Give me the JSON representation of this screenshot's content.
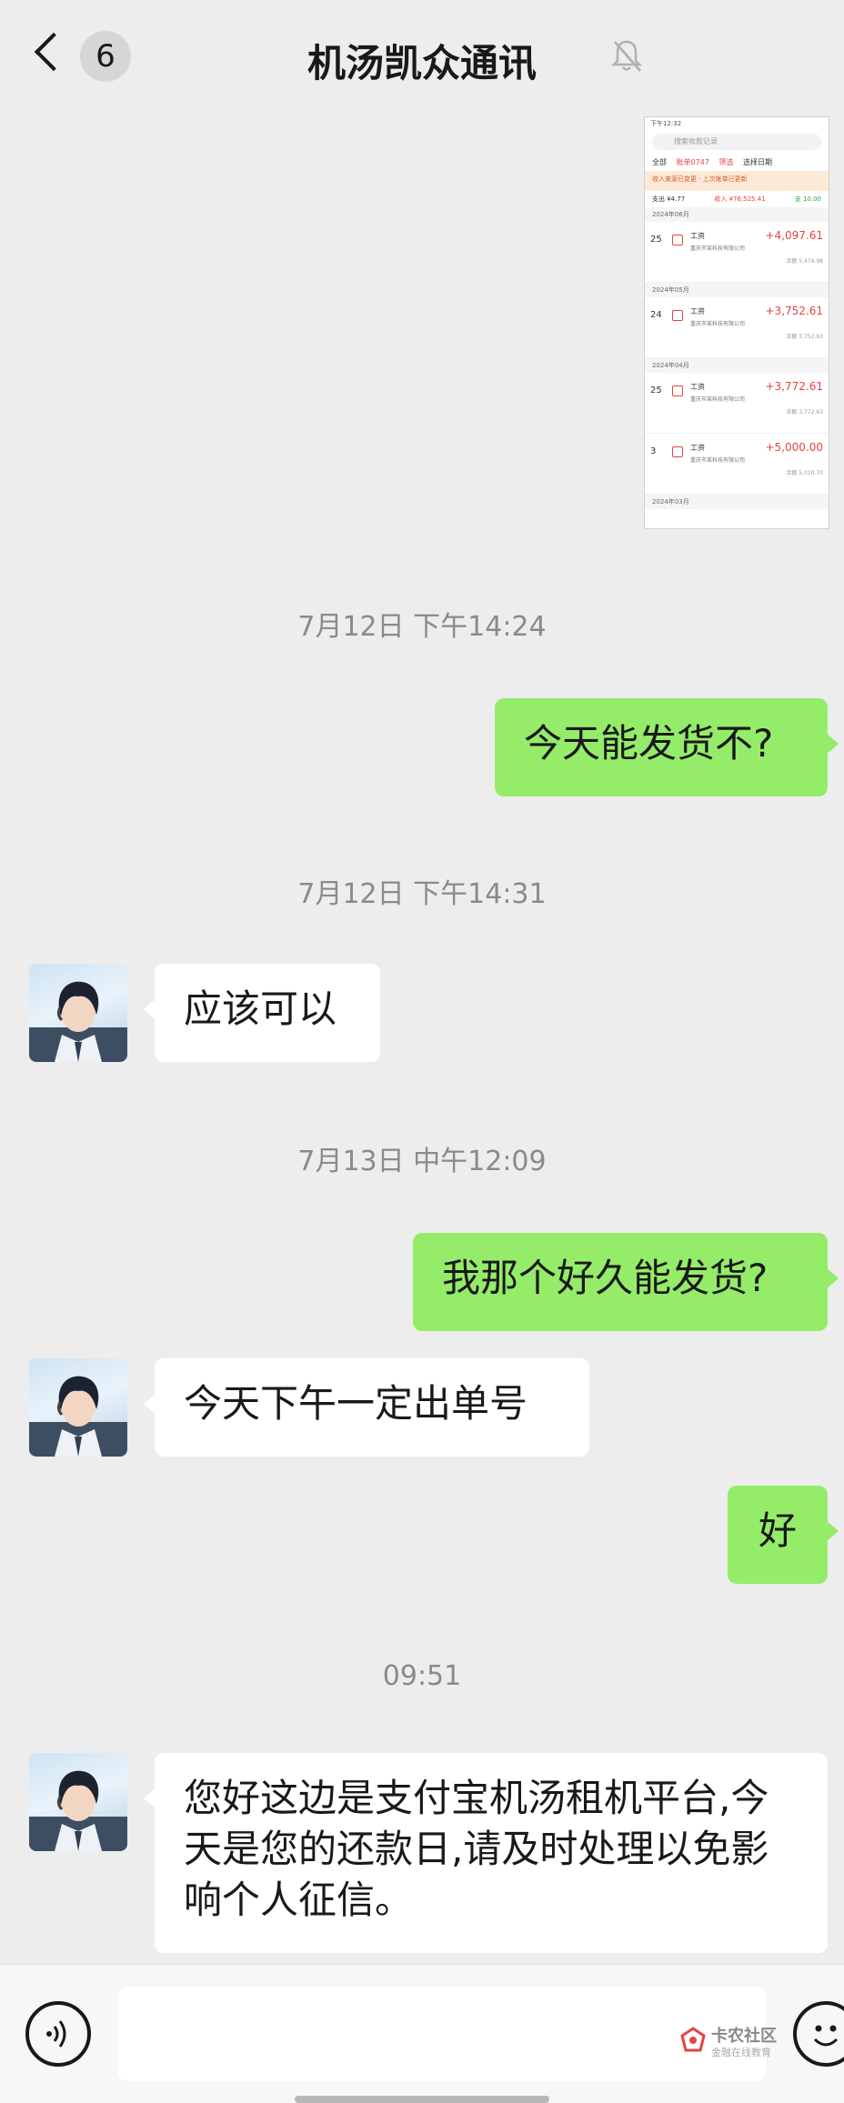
{
  "header": {
    "back_badge": "6",
    "title": "机汤凯众通讯"
  },
  "thumbnail": {
    "status": "下午12:32",
    "search_placeholder": "搜索收款记录",
    "filters": [
      "全部",
      "账单0747",
      "筛选",
      "选择日期"
    ],
    "notice": "收入来源已变更 · 上次账单已更新",
    "summary": {
      "expense": "支出 ¥4.77",
      "income": "收入 ¥76,525.41",
      "other": "支 10.00"
    },
    "records": [
      {
        "month": "2024年06月",
        "day": "25",
        "name": "工资",
        "company": "重庆市某科技有限公司",
        "amount": "+4,097.61",
        "balance": "余额 5,474.98"
      },
      {
        "month": "2024年05月",
        "day": "24",
        "name": "工资",
        "company": "重庆市某科技有限公司",
        "amount": "+3,752.61",
        "balance": "余额 3,752.63"
      },
      {
        "month": "2024年04月",
        "day": "25",
        "name": "工资",
        "company": "重庆市某科技有限公司",
        "amount": "+3,772.61",
        "balance": "余额 3,772.63"
      },
      {
        "month": "",
        "day": "3",
        "name": "工资",
        "company": "重庆市某科技有限公司",
        "amount": "+5,000.00",
        "balance": "余额 5,010.70"
      }
    ],
    "footer_month": "2024年03月"
  },
  "timestamps": [
    "7月12日 下午14:24",
    "7月12日 下午14:31",
    "7月13日 中午12:09",
    "09:51"
  ],
  "messages": [
    {
      "text": "今天能发货不?"
    },
    {
      "text": "应该可以"
    },
    {
      "text": "我那个好久能发货?"
    },
    {
      "text": "今天下午一定出单号"
    },
    {
      "text": "好"
    },
    {
      "text": "您好这边是支付宝机汤租机平台,今天是您的还款日,请及时处理以免影响个人征信。"
    }
  ],
  "watermark": {
    "name": "卡农社区",
    "sub": "金融在线教育"
  }
}
